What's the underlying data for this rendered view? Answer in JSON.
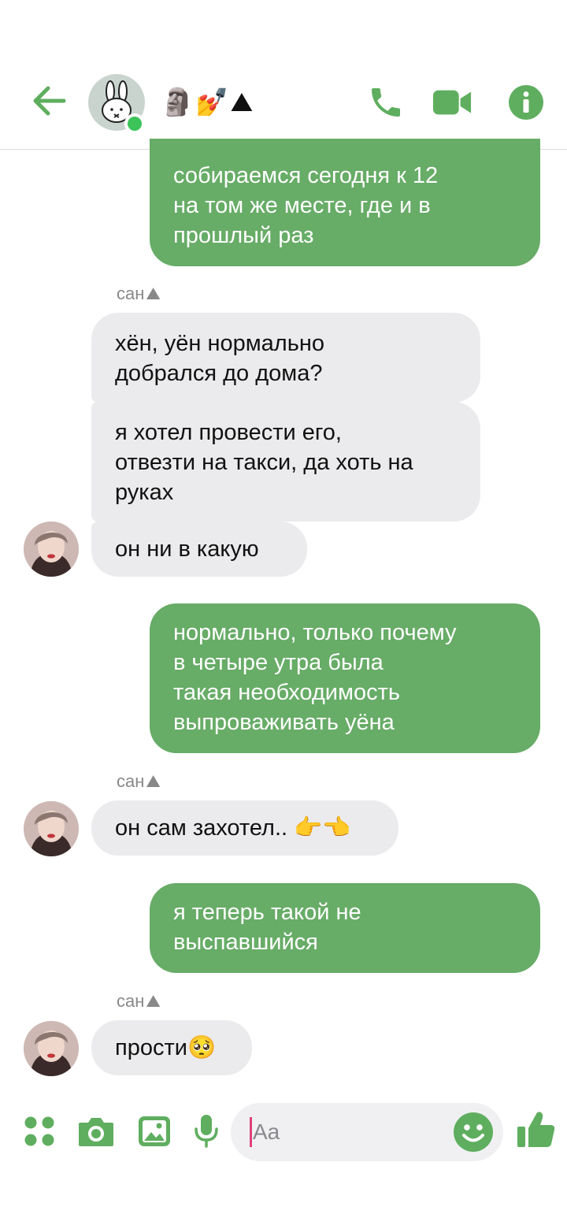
{
  "header": {
    "chat_title": "🗿💅⛰",
    "online": true
  },
  "messages": [
    {
      "dir": "out",
      "lines": [
        "собираемся сегодня к 12",
        "на том же месте, где и в",
        "прошлый раз"
      ]
    },
    {
      "dir": "in",
      "sender": "сан",
      "sender_emoji": "⛰",
      "lines": [
        "хён, уён нормально",
        "добрался до дома?"
      ]
    },
    {
      "dir": "in",
      "lines": [
        "я хотел провести его,",
        "отвезти на такси, да хоть на",
        "руках"
      ]
    },
    {
      "dir": "in",
      "lines": [
        "он ни в какую"
      ]
    },
    {
      "dir": "out",
      "lines": [
        "нормально, только почему",
        "в четыре утра была",
        "такая необходимость",
        "выпроваживать уёна"
      ]
    },
    {
      "dir": "in",
      "sender": "сан",
      "sender_emoji": "⛰",
      "lines": [
        "он сам захотел.. 👉👈"
      ]
    },
    {
      "dir": "out",
      "lines": [
        "я теперь такой не",
        "выспавшийся"
      ]
    },
    {
      "dir": "in",
      "sender": "сан",
      "sender_emoji": "⛰",
      "lines": [
        "прости🥺"
      ]
    }
  ],
  "composer": {
    "placeholder": "Aa"
  },
  "colors": {
    "accent": "#5fae5f",
    "outgoing_bubble": "#67ac67",
    "incoming_bubble": "#ebebed",
    "online": "#3cc35a"
  },
  "icons": [
    "back-arrow-icon",
    "phone-icon",
    "video-camera-icon",
    "info-icon",
    "apps-grid-icon",
    "camera-icon",
    "gallery-icon",
    "microphone-icon",
    "emoji-icon",
    "thumbs-up-icon"
  ]
}
